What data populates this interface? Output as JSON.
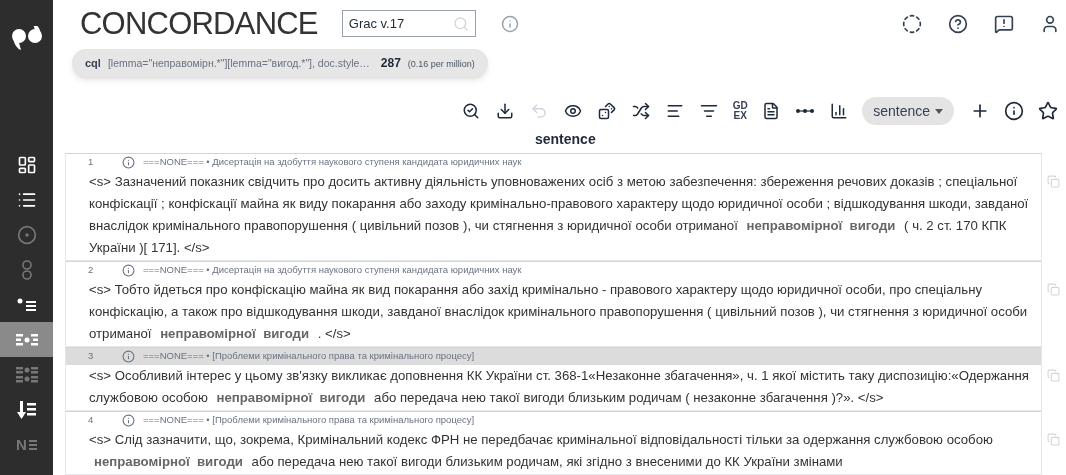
{
  "sidebar": {
    "items": [
      {
        "kind": "dashboard",
        "selected": false
      },
      {
        "kind": "list",
        "selected": false
      },
      {
        "kind": "target",
        "selected": false
      },
      {
        "kind": "circles",
        "selected": false
      },
      {
        "kind": "dotlist",
        "selected": false
      },
      {
        "kind": "kwic",
        "selected": true
      },
      {
        "kind": "kwic2",
        "selected": false
      },
      {
        "kind": "sortdown",
        "selected": false
      },
      {
        "kind": "glyph",
        "glyph": "N",
        "selected": false
      }
    ]
  },
  "header": {
    "title": "CONCORDANCE",
    "corpus_field": {
      "value": "Grac v.17"
    }
  },
  "query": {
    "label": "cql",
    "text": "[lemma=\"неправомірн.*\"][lemma=\"вигод.*\"], doc.style…",
    "count": "287",
    "frequency": "(0.16 per million)"
  },
  "toolbar": {
    "items": [
      {
        "kind": "search-refresh",
        "disabled": false
      },
      {
        "kind": "download",
        "disabled": false
      },
      {
        "kind": "undo",
        "disabled": true
      },
      {
        "kind": "eye",
        "disabled": false
      },
      {
        "kind": "dice",
        "disabled": false
      },
      {
        "kind": "shuffle",
        "disabled": false
      },
      {
        "kind": "sort",
        "disabled": false
      },
      {
        "kind": "filter",
        "disabled": false
      },
      {
        "kind": "text",
        "label": "GD EX",
        "disabled": false
      },
      {
        "kind": "doc",
        "disabled": false
      },
      {
        "kind": "dots",
        "disabled": false
      },
      {
        "kind": "chart",
        "disabled": false
      }
    ],
    "view_select": "sentence"
  },
  "column_heading": "sentence",
  "rows": [
    {
      "number": "1",
      "meta": "===NONE=== • Дисертація на здобуття наукового ступеня кандидата юридичних наук",
      "selected": false,
      "text": "<s> Зазначений показник свідчить про досить активну діяльність уповноважених осіб з метою забезпечення: збереження речових доказів ; спеціальної конфіскації ; конфіскації майна як виду покарання або заходу кримінально-правового характеру щодо юридичної особи ; відшкодування шкоди, завданої внаслідок кримінального правопорушення ( цивільний позов ), чи стягнення з юридичної особи отриманої",
      "keyword": "неправомірної  вигоди",
      "right": "( ч. 2 ст. 170 КПК України )[ 171]. </s>"
    },
    {
      "number": "2",
      "meta": "===NONE=== • Дисертація на здобуття наукового ступеня кандидата юридичних наук",
      "selected": false,
      "text": "<s> Тобто йдеться про конфіскацію майна як вид покарання або захід кримінально - правового характеру щодо юридичної особи, про спеціальну конфіскацію, а також про відшкодування шкоди, завданої внаслідок кримінального правопорушення ( цивільний позов ), чи стягнення з юридичної особи отриманої",
      "keyword": "неправомірної  вигоди",
      "right": ". </s>"
    },
    {
      "number": "3",
      "meta": "===NONE=== • [Проблеми кримінального права та кримінального процесу]",
      "selected": true,
      "text": "<s> Особливий інтерес у цьому зв'язку викликає доповнення КК України ст. 368-1«Незаконне збагачення», ч. 1 якої містить таку диспозицію:«Одержання службовою особою",
      "keyword": "неправомірної  вигоди",
      "right": "або передача нею такої вигоди близьким родичам ( незаконне збагачення )?». </s>"
    },
    {
      "number": "4",
      "meta": "===NONE=== • [Проблеми кримінального права та кримінального процесу]",
      "selected": false,
      "text": "<s> Слід зазначити, що, зокрема, Кримінальний кодекс ФРН не передбачає кримінальної відповідальності тільки за одержання службовою особою",
      "keyword": "неправомірної  вигоди",
      "right": "або передача нею такої вигоди близьким родичам, які згідно з внесеними до КК України змінами"
    }
  ]
}
